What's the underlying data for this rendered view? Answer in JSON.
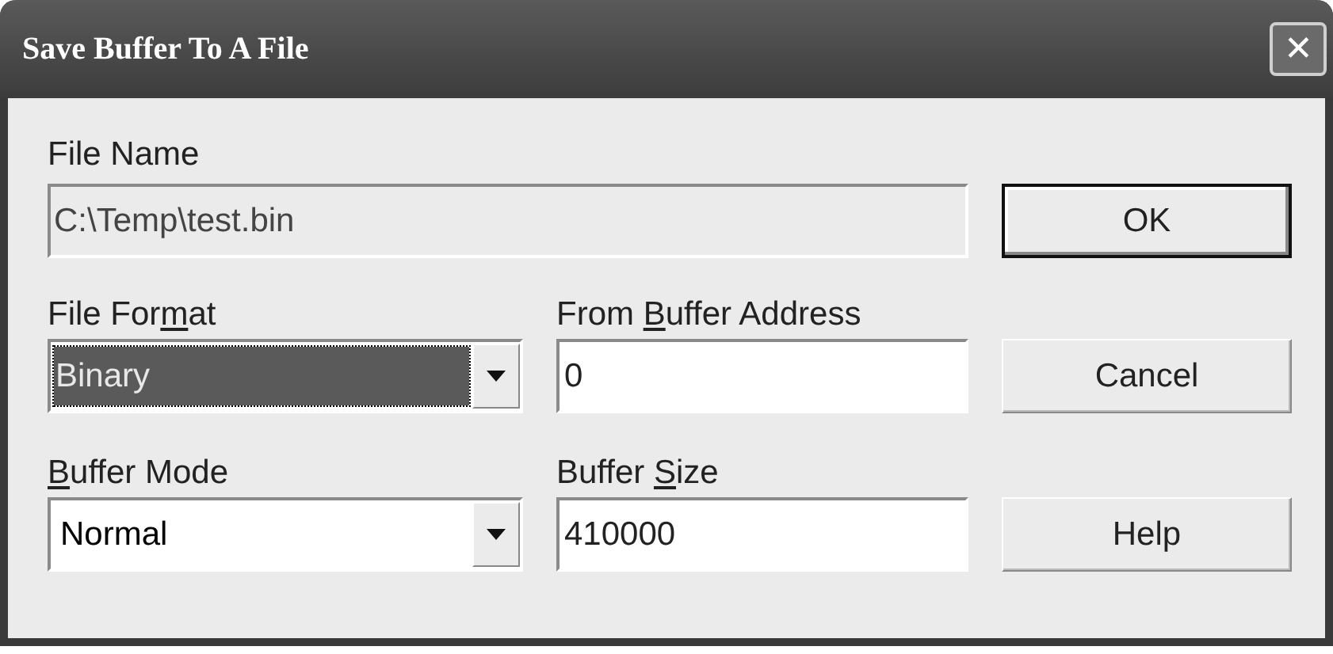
{
  "window": {
    "title": "Save Buffer To A File",
    "close_glyph": "✕"
  },
  "file_name": {
    "label": "File Name",
    "value": "C:\\Temp\\test.bin",
    "disabled": true
  },
  "file_format": {
    "label_before": "File For",
    "access_key": "m",
    "label_after": "at",
    "value": "Binary",
    "focused": true
  },
  "from_buffer_address": {
    "label_before": "From ",
    "access_key": "B",
    "label_after": "uffer Address",
    "value": "0"
  },
  "buffer_mode": {
    "access_key": "B",
    "label_after": "uffer Mode",
    "value": "Normal",
    "focused": false
  },
  "buffer_size": {
    "label_before": "Buffer ",
    "access_key": "S",
    "label_after": "ize",
    "value": "410000"
  },
  "buttons": [
    {
      "label": "OK",
      "default": true
    },
    {
      "label": "Cancel",
      "default": false
    },
    {
      "label": "Help",
      "default": false
    }
  ]
}
